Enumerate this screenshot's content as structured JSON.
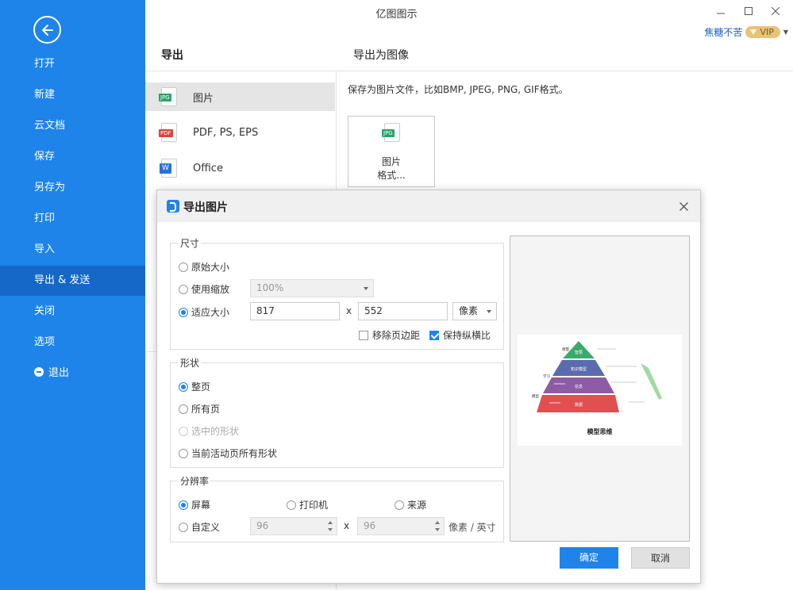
{
  "app": {
    "title": "亿图图示",
    "user": "焦糖不苦",
    "vip": "VIP"
  },
  "sidebar": {
    "items": [
      {
        "label": "打开"
      },
      {
        "label": "新建"
      },
      {
        "label": "云文档"
      },
      {
        "label": "保存"
      },
      {
        "label": "另存为"
      },
      {
        "label": "打印"
      },
      {
        "label": "导入"
      },
      {
        "label": "导出 & 发送",
        "active": true
      },
      {
        "label": "关闭"
      },
      {
        "label": "选项"
      },
      {
        "label": "退出"
      }
    ]
  },
  "export_panel": {
    "header": "导出",
    "formats": [
      {
        "label": "图片",
        "icon": "jpg-file-icon",
        "tag": "JPG",
        "color": "#2aa36b"
      },
      {
        "label": "PDF, PS, EPS",
        "icon": "pdf-file-icon",
        "tag": "PDF",
        "color": "#e0443a"
      },
      {
        "label": "Office",
        "icon": "word-file-icon",
        "tag": "W",
        "color": "#2b6fd6"
      }
    ]
  },
  "image_panel": {
    "header": "导出为图像",
    "description": "保存为图片文件，比如BMP, JPEG, PNG, GIF格式。",
    "card_tag": "JPG",
    "card_line1": "图片",
    "card_line2": "格式..."
  },
  "dialog": {
    "title": "导出图片",
    "size": {
      "title": "尺寸",
      "original": "原始大小",
      "use_zoom": "使用缩放",
      "zoom_value": "100%",
      "fit": "适应大小",
      "width": "817",
      "height": "552",
      "times": "x",
      "unit": "像素",
      "remove_margin": "移除页边距",
      "keep_ratio": "保持纵横比",
      "selected": "fit"
    },
    "shape": {
      "title": "形状",
      "whole_page": "整页",
      "all_pages": "所有页",
      "selected_shapes": "选中的形状",
      "current_page_all": "当前活动页所有形状",
      "selected": "whole_page"
    },
    "resolution": {
      "title": "分辨率",
      "screen": "屏幕",
      "printer": "打印机",
      "source": "来源",
      "custom": "自定义",
      "dpi_x": "96",
      "dpi_y": "96",
      "times": "x",
      "unit": "像素 / 英寸",
      "selected": "screen"
    },
    "preview": {
      "caption": "模型思维",
      "side_labels": [
        "德慧",
        "学习",
        "模型"
      ],
      "levels": [
        {
          "label": "智慧",
          "color": "#3aaa6a"
        },
        {
          "label": "知识模型",
          "color": "#5b6bb0"
        },
        {
          "label": "信息",
          "color": "#8e5ba6"
        },
        {
          "label": "数据",
          "color": "#e05050"
        }
      ]
    },
    "ok": "确定",
    "cancel": "取消"
  }
}
